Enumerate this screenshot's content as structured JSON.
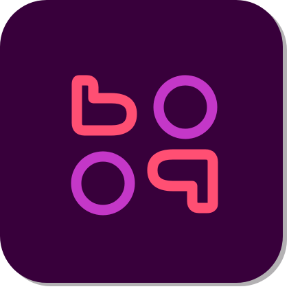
{
  "app_icon": {
    "icon_name": "app-logo-icon",
    "colors": {
      "tile_background": "#38003b",
      "tile_shadow": "#a6a3a6",
      "heart_color": "#ff4f73",
      "circle_color": "#c437c8"
    },
    "glyphs": [
      {
        "position": "top-left",
        "shape": "heart-icon"
      },
      {
        "position": "top-right",
        "shape": "circle-icon"
      },
      {
        "position": "bottom-left",
        "shape": "circle-icon"
      },
      {
        "position": "bottom-right",
        "shape": "heart-icon"
      }
    ]
  }
}
